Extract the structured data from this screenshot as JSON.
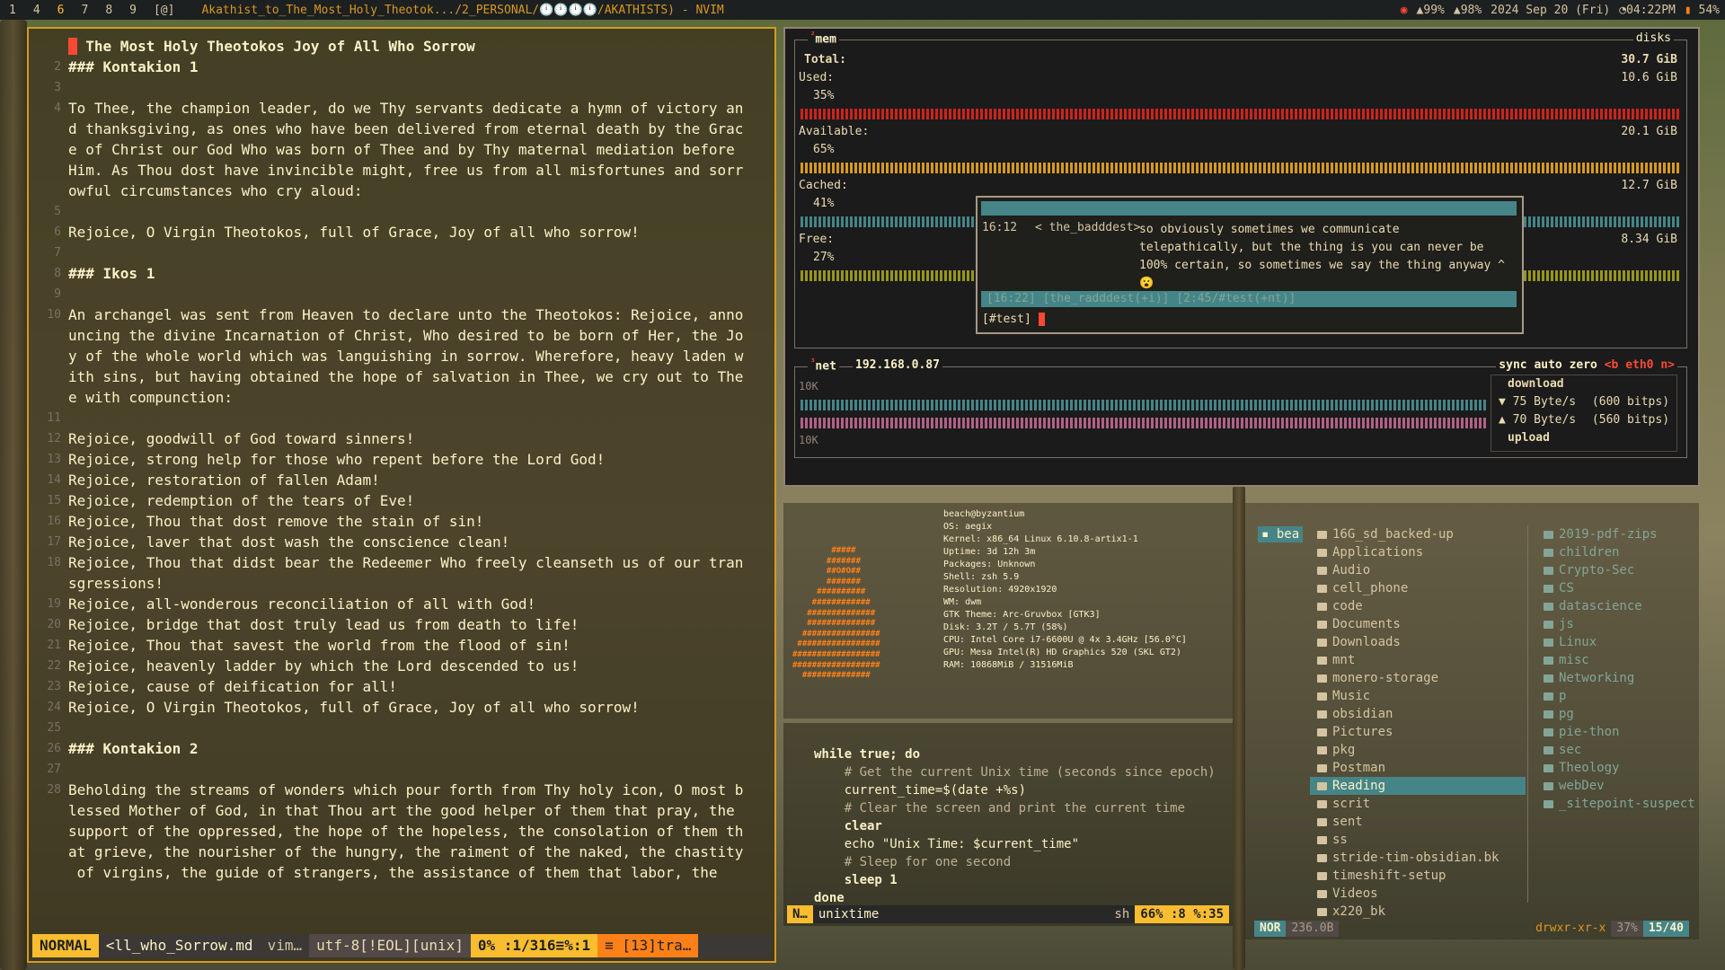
{
  "topbar": {
    "workspaces": [
      "1",
      "4",
      "6",
      "7",
      "8",
      "9"
    ],
    "active_workspace": "6",
    "layout": "[@]",
    "window_title": "Akathist_to_The_Most_Holy_Theotok.../2_PERSONAL/🕛🕛🕛🕛/AKATHISTS) - NVIM",
    "status": [
      "99%",
      "98%",
      "2024 Sep 20 (Fri)",
      "04:22PM",
      "54%"
    ]
  },
  "nvim": {
    "lines": [
      {
        "n": "",
        "t": " The Most Holy Theotokos Joy of All Who Sorrow",
        "h": true,
        "cursor": true
      },
      {
        "n": "2",
        "t": "### Kontakion 1",
        "h": true
      },
      {
        "n": "3",
        "t": ""
      },
      {
        "n": "4",
        "t": "To Thee, the champion leader, do we Thy servants dedicate a hymn of victory an"
      },
      {
        "n": "",
        "t": "d thanksgiving, as ones who have been delivered from eternal death by the Grac"
      },
      {
        "n": "",
        "t": "e of Christ our God Who was born of Thee and by Thy maternal mediation before"
      },
      {
        "n": "",
        "t": "Him. As Thou dost have invincible might, free us from all misfortunes and sorr"
      },
      {
        "n": "",
        "t": "owful circumstances who cry aloud:"
      },
      {
        "n": "5",
        "t": ""
      },
      {
        "n": "6",
        "t": "Rejoice, O Virgin Theotokos, full of Grace, Joy of all who sorrow!"
      },
      {
        "n": "7",
        "t": ""
      },
      {
        "n": "8",
        "t": "### Ikos 1",
        "h": true
      },
      {
        "n": "9",
        "t": ""
      },
      {
        "n": "10",
        "t": "An archangel was sent from Heaven to declare unto the Theotokos: Rejoice, anno"
      },
      {
        "n": "",
        "t": "uncing the divine Incarnation of Christ, Who desired to be born of Her, the Jo"
      },
      {
        "n": "",
        "t": "y of the whole world which was languishing in sorrow. Wherefore, heavy laden w"
      },
      {
        "n": "",
        "t": "ith sins, but having obtained the hope of salvation in Thee, we cry out to The"
      },
      {
        "n": "",
        "t": "e with compunction:"
      },
      {
        "n": "11",
        "t": ""
      },
      {
        "n": "12",
        "t": "Rejoice, goodwill of God toward sinners!"
      },
      {
        "n": "13",
        "t": "Rejoice, strong help for those who repent before the Lord God!"
      },
      {
        "n": "14",
        "t": "Rejoice, restoration of fallen Adam!"
      },
      {
        "n": "15",
        "t": "Rejoice, redemption of the tears of Eve!"
      },
      {
        "n": "16",
        "t": "Rejoice, Thou that dost remove the stain of sin!"
      },
      {
        "n": "17",
        "t": "Rejoice, laver that dost wash the conscience clean!"
      },
      {
        "n": "18",
        "t": "Rejoice, Thou that didst bear the Redeemer Who freely cleanseth us of our tran"
      },
      {
        "n": "",
        "t": "sgressions!"
      },
      {
        "n": "19",
        "t": "Rejoice, all-wonderous reconciliation of all with God!"
      },
      {
        "n": "20",
        "t": "Rejoice, bridge that dost truly lead us from death to life!"
      },
      {
        "n": "21",
        "t": "Rejoice, Thou that savest the world from the flood of sin!"
      },
      {
        "n": "22",
        "t": "Rejoice, heavenly ladder by which the Lord descended to us!"
      },
      {
        "n": "23",
        "t": "Rejoice, cause of deification for all!"
      },
      {
        "n": "24",
        "t": "Rejoice, O Virgin Theotokos, full of Grace, Joy of all who sorrow!"
      },
      {
        "n": "25",
        "t": ""
      },
      {
        "n": "26",
        "t": "### Kontakion 2",
        "h": true
      },
      {
        "n": "27",
        "t": ""
      },
      {
        "n": "28",
        "t": "Beholding the streams of wonders which pour forth from Thy holy icon, O most b"
      },
      {
        "n": "",
        "t": "lessed Mother of God, in that Thou art the good helper of them that pray, the"
      },
      {
        "n": "",
        "t": "support of the oppressed, the hope of the hopeless, the consolation of them th"
      },
      {
        "n": "",
        "t": "at grieve, the nourisher of the hungry, the raiment of the naked, the chastity"
      },
      {
        "n": "",
        "t": " of virgins, the guide of strangers, the assistance of them that labor, the"
      }
    ],
    "status": {
      "mode": "NORMAL",
      "file": "<ll_who_Sorrow.md",
      "ft": "vim…",
      "enc": "utf-8[!EOL][unix]",
      "pos": "0%  :1/316≡%:1",
      "warn": "≡ [13]tra…"
    }
  },
  "btop": {
    "mem_title": "mem",
    "mem_num": "²",
    "disks_title": "disks",
    "total_label": "Total:",
    "total_value": "30.7 GiB",
    "used_label": "Used:",
    "used_pct": "35%",
    "used_value": "10.6 GiB",
    "avail_label": "Available:",
    "avail_pct": "65%",
    "avail_value": "20.1 GiB",
    "cached_label": "Cached:",
    "cached_pct": "41%",
    "cached_value": "12.7 GiB",
    "free_label": "Free:",
    "free_pct": "27%",
    "free_value": "8.34 GiB",
    "net_num": "³",
    "net_title": "net",
    "ip": "192.168.0.87",
    "net_opts": [
      "sync",
      "auto",
      "zero",
      "<b eth0 n>"
    ],
    "scale_top": "10K",
    "scale_bottom": "10K",
    "download_label": "download",
    "upload_label": "upload",
    "down_rate": "▼ 75 Byte/s",
    "down_bits": "(600 bitps)",
    "up_rate": "▲ 70 Byte/s",
    "up_bits": "(560 bitps)",
    "colors": {
      "used": "#cc241d",
      "avail": "#d79921",
      "cached": "#458588",
      "free": "#98971a",
      "net": "#458588",
      "netup": "#b16286"
    }
  },
  "irc": {
    "time": "16:12",
    "nick": "< the_badddest>",
    "message": "so obviously sometimes we communicate telepathically, but the thing is you can never be 100% certain, so sometimes we say the thing anyway ^",
    "emoji": "😮",
    "status": "[16:22] [the_radddest(+i)] [2:45/#test(+nt)]",
    "input": "[#test]"
  },
  "fetch": {
    "user": "beach@byzantium",
    "info": [
      "OS: aegix",
      "Kernel: x86_64 Linux 6.10.8-artix1-1",
      "Uptime: 3d 12h 3m",
      "Packages: Unknown",
      "Shell: zsh 5.9",
      "Resolution: 4920x1920",
      "WM: dwm",
      "GTK Theme: Arc-Gruvbox [GTK3]",
      "Disk: 3.2T / 5.7T (58%)",
      "CPU: Intel Core i7-6600U @ 4x 3.4GHz [56.0°C]",
      "GPU: Mesa Intel(R) HD Graphics 520 (SKL GT2)",
      "RAM: 10868MiB / 31516MiB"
    ],
    "logo": "        #####\n       #######\n       ##O#O##\n       #######\n     ##########\n    ############\n   ##############\n   ##############\n  ################\n #################\n##################\n##################\n  ##############"
  },
  "shell": {
    "lines": [
      {
        "c": "kw",
        "t": "while true; do"
      },
      {
        "c": "cm",
        "t": "    # Get the current Unix time (seconds since epoch)"
      },
      {
        "c": "str",
        "t": "    current_time=$(date +%s)"
      },
      {
        "c": "cm",
        "t": "    # Clear the screen and print the current time"
      },
      {
        "c": "kw",
        "t": "    clear"
      },
      {
        "c": "str",
        "t": "    echo \"Unix Time: $current_time\""
      },
      {
        "c": "cm",
        "t": "    # Sleep for one second"
      },
      {
        "c": "kw",
        "t": "    sleep 1"
      },
      {
        "c": "kw",
        "t": "done"
      }
    ],
    "status": {
      "mode": "N…",
      "file": "unixtime",
      "ft": "sh",
      "pos": "66%  :8 %:35"
    }
  },
  "fm": {
    "home": "bea",
    "col2": [
      "16G_sd_backed-up",
      "Applications",
      "Audio",
      "cell_phone",
      "code",
      "Documents",
      "Downloads",
      "mnt",
      "monero-storage",
      "Music",
      "obsidian",
      "Pictures",
      "pkg",
      "Postman",
      "Reading",
      "scrit",
      "sent",
      "ss",
      "stride-tim-obsidian.bk",
      "timeshift-setup",
      "Videos",
      "x220_bk"
    ],
    "selected": "Reading",
    "col3": [
      "2019-pdf-zips",
      "children",
      "Crypto-Sec",
      "CS",
      "datascience",
      "js",
      "Linux",
      "misc",
      "Networking",
      "p",
      "pg",
      "pie-thon",
      "sec",
      "Theology",
      "webDev",
      "_sitepoint-suspect"
    ],
    "status": {
      "mode": "NOR",
      "size": "236.0B",
      "perms": "drwxr-xr-x",
      "pct": "37%",
      "count": "15/40"
    }
  }
}
